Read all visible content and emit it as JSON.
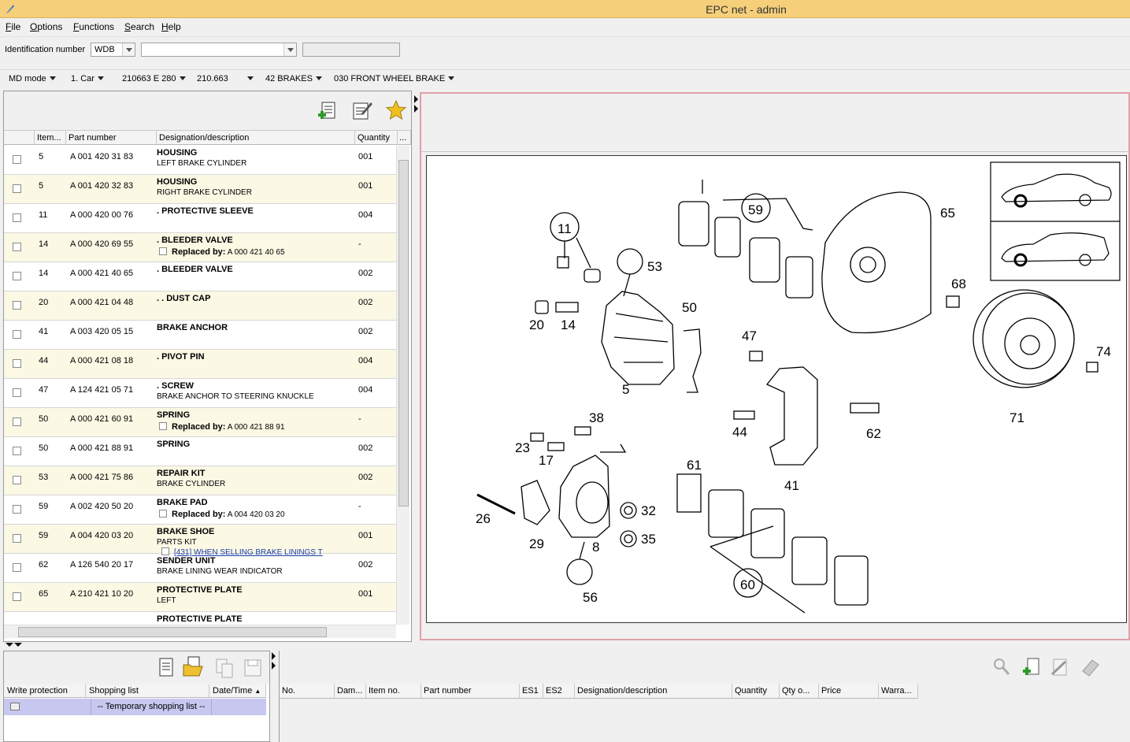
{
  "window": {
    "title": "EPC net - admin"
  },
  "menu": [
    "File",
    "Options",
    "Functions",
    "Search",
    "Help"
  ],
  "identification": {
    "label": "Identification number",
    "prefix": "WDB",
    "value": "",
    "extra": ""
  },
  "nav": [
    "MD mode",
    "1. Car",
    "210663 E 280",
    "210.663",
    "42 BRAKES",
    "030 FRONT WHEEL BRAKE"
  ],
  "parts_table": {
    "columns": [
      "",
      "Item...",
      "Part number",
      "Designation/description",
      "Quantity",
      "..."
    ],
    "rows": [
      {
        "item": "5",
        "part": "A 001 420 31 83",
        "d1": "HOUSING",
        "d2": "LEFT BRAKE CYLINDER",
        "qty": "001"
      },
      {
        "item": "5",
        "part": "A 001 420 32 83",
        "d1": "HOUSING",
        "d2": "RIGHT BRAKE CYLINDER",
        "qty": "001"
      },
      {
        "item": "11",
        "part": "A 000 420 00 76",
        "d1": ". PROTECTIVE SLEEVE",
        "d2": "",
        "qty": "004"
      },
      {
        "item": "14",
        "part": "A 000 420 69 55",
        "d1": ". BLEEDER VALVE",
        "d2_label": "Replaced by:",
        "d2": "A 000 421 40 65",
        "qty": "-"
      },
      {
        "item": "14",
        "part": "A 000 421 40 65",
        "d1": ". BLEEDER VALVE",
        "d2": "",
        "qty": "002"
      },
      {
        "item": "20",
        "part": "A 000 421 04 48",
        "d1": ". . DUST CAP",
        "d2": "",
        "qty": "002"
      },
      {
        "item": "41",
        "part": "A 003 420 05 15",
        "d1": "BRAKE ANCHOR",
        "d2": "",
        "qty": "002"
      },
      {
        "item": "44",
        "part": "A 000 421 08 18",
        "d1": ". PIVOT PIN",
        "d2": "",
        "qty": "004"
      },
      {
        "item": "47",
        "part": "A 124 421 05 71",
        "d1": ". SCREW",
        "d2": "BRAKE ANCHOR TO STEERING KNUCKLE",
        "qty": "004"
      },
      {
        "item": "50",
        "part": "A 000 421 60 91",
        "d1": "SPRING",
        "d2_label": "Replaced by:",
        "d2": "A 000 421 88 91",
        "qty": "-"
      },
      {
        "item": "50",
        "part": "A 000 421 88 91",
        "d1": "SPRING",
        "d2": "",
        "qty": "002"
      },
      {
        "item": "53",
        "part": "A 000 421 75 86",
        "d1": "REPAIR KIT",
        "d2": "BRAKE CYLINDER",
        "qty": "002"
      },
      {
        "item": "59",
        "part": "A 002 420 50 20",
        "d1": "BRAKE PAD",
        "d2_label": "Replaced by:",
        "d2": "A 004 420 03 20",
        "qty": "-"
      },
      {
        "item": "59",
        "part": "A 004 420 03 20",
        "d1": "BRAKE SHOE",
        "d2": "PARTS KIT",
        "d3_link": "[431] WHEN SELLING BRAKE LININGS T",
        "qty": "001"
      },
      {
        "item": "62",
        "part": "A 126 540 20 17",
        "d1": "SENDER UNIT",
        "d2": "BRAKE LINING WEAR INDICATOR",
        "qty": "002"
      },
      {
        "item": "65",
        "part": "A 210 421 10 20",
        "d1": "PROTECTIVE PLATE",
        "d2": "LEFT",
        "qty": "001"
      },
      {
        "item": "",
        "part": "",
        "d1": "PROTECTIVE PLATE",
        "d2": "",
        "qty": ""
      }
    ]
  },
  "diagram": {
    "labels": [
      "5",
      "8",
      "11",
      "14",
      "17",
      "20",
      "23",
      "26",
      "29",
      "32",
      "35",
      "38",
      "41",
      "44",
      "47",
      "50",
      "53",
      "56",
      "59",
      "60",
      "61",
      "62",
      "65",
      "68",
      "71",
      "74"
    ]
  },
  "shopping": {
    "columns": [
      "Write protection",
      "Shopping list",
      "Date/Time"
    ],
    "row": "-- Temporary shopping list --"
  },
  "cart": {
    "columns": [
      "No.",
      "Dam...",
      "Item no.",
      "Part number",
      "ES1",
      "ES2",
      "Designation/description",
      "Quantity",
      "Qty o...",
      "Price",
      "Warra..."
    ]
  }
}
